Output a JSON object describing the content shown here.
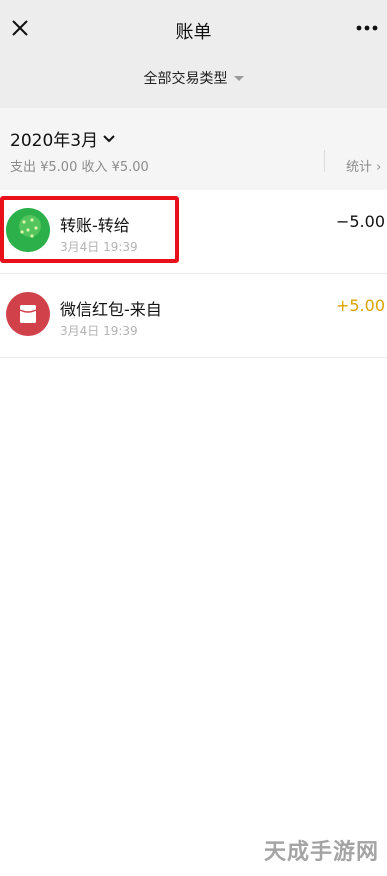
{
  "header": {
    "title": "账单",
    "close_icon": "close-icon",
    "more_icon": "more-horizontal-icon"
  },
  "filter": {
    "label": "全部交易类型"
  },
  "month": {
    "label": "2020年3月",
    "summary": "支出 ¥5.00 收入 ¥5.00",
    "stats_label": "统计 ›"
  },
  "transactions": [
    {
      "title": "转账-转给",
      "time": "3月4日 19:39",
      "amount": "−5.00",
      "type": "expense",
      "icon": "transfer-avatar"
    },
    {
      "title": "微信红包-来自",
      "time": "3月4日 19:39",
      "amount": "+5.00",
      "type": "income",
      "icon": "red-packet-icon"
    }
  ],
  "colors": {
    "income": "#d9a400",
    "highlight": "#e8111b",
    "header_bg": "#ededed"
  },
  "watermark": "天成手游网"
}
